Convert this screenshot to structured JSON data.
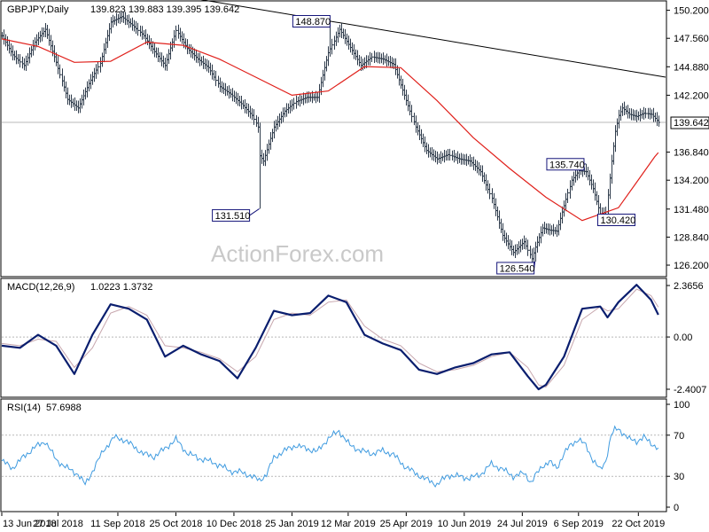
{
  "header": {
    "symbol": "GBPJPY,Daily",
    "ohlc": "139.823 139.883 139.395 139.642"
  },
  "watermark": "ActionForex.com",
  "colors": {
    "background": "#ffffff",
    "price_bars": "#2d3a4a",
    "sma": "#e0201b",
    "trendline": "#000000",
    "macd_line": "#0a1e6e",
    "macd_signal": "#c7a6ad",
    "rsi_line": "#3f9be0",
    "current_price_label_bg": "#ffffff",
    "annotation_border": "#15157a"
  },
  "chart_data": [
    {
      "type": "line",
      "title": "GBPJPY,Daily",
      "subtitle": "139.823 139.883 139.395 139.642",
      "ylim": [
        125.2,
        151.0
      ],
      "y_ticks": [
        "150.200",
        "147.560",
        "144.880",
        "142.200",
        "139.642",
        "136.840",
        "134.200",
        "131.480",
        "128.840",
        "126.200"
      ],
      "x_ticks": [
        {
          "label": "13 Jun 2018",
          "index": 0
        },
        {
          "label": "27 Jul 2018",
          "index": 31
        },
        {
          "label": "11 Sep 2018",
          "index": 64
        },
        {
          "label": "25 Oct 2018",
          "index": 96
        },
        {
          "label": "10 Dec 2018",
          "index": 128
        },
        {
          "label": "25 Jan 2019",
          "index": 160
        },
        {
          "label": "12 Mar 2019",
          "index": 191
        },
        {
          "label": "25 Apr 2019",
          "index": 223
        },
        {
          "label": "10 Jun 2019",
          "index": 255
        },
        {
          "label": "24 Jul 2019",
          "index": 287
        },
        {
          "label": "6 Sep 2019",
          "index": 318
        },
        {
          "label": "22 Oct 2019",
          "index": 351
        }
      ],
      "last_price": {
        "value": 139.642,
        "label": "139.642"
      },
      "annotations": [
        {
          "label": "148.870",
          "index": 181,
          "value": 148.87
        },
        {
          "label": "131.510",
          "index": 142,
          "value": 131.51
        },
        {
          "label": "135.740",
          "index": 322,
          "value": 135.74
        },
        {
          "label": "130.420",
          "index": 333,
          "value": 130.42
        },
        {
          "label": "126.540",
          "index": 294,
          "value": 126.54
        }
      ],
      "trendline": [
        {
          "index": 110,
          "value": 151.2
        },
        {
          "index": 366,
          "value": 143.9
        }
      ],
      "series": [
        {
          "type": "close",
          "x": [
            0,
            6,
            12,
            18,
            24,
            30,
            36,
            42,
            48,
            54,
            60,
            66,
            72,
            78,
            84,
            90,
            96,
            102,
            108,
            114,
            120,
            126,
            132,
            138,
            141,
            142,
            144,
            150,
            156,
            162,
            168,
            174,
            180,
            186,
            192,
            198,
            204,
            210,
            216,
            222,
            228,
            234,
            240,
            246,
            252,
            258,
            264,
            270,
            276,
            282,
            288,
            292,
            294,
            298,
            302,
            306,
            310,
            314,
            318,
            322,
            326,
            330,
            333,
            336,
            338,
            340,
            342,
            346,
            350,
            354,
            358,
            362
          ],
          "values": [
            147.8,
            146.0,
            145.0,
            147.2,
            148.4,
            145.3,
            141.8,
            141.0,
            143.3,
            145.2,
            149.1,
            149.6,
            148.8,
            147.8,
            146.3,
            145.0,
            148.3,
            146.6,
            145.6,
            144.8,
            143.0,
            142.3,
            141.4,
            140.3,
            139.2,
            136.5,
            136.0,
            139.2,
            140.7,
            141.6,
            142.0,
            142.0,
            146.2,
            148.4,
            146.7,
            145.0,
            145.8,
            145.6,
            145.1,
            142.2,
            139.2,
            137.0,
            136.2,
            136.6,
            136.2,
            136.0,
            135.0,
            132.5,
            129.0,
            127.4,
            128.4,
            126.8,
            127.9,
            129.7,
            129.5,
            129.4,
            131.8,
            134.2,
            135.1,
            135.0,
            133.4,
            131.0,
            131.2,
            136.0,
            138.8,
            140.3,
            141.0,
            140.4,
            140.2,
            140.5,
            140.4,
            139.642
          ]
        },
        {
          "type": "sma",
          "x": [
            0,
            20,
            40,
            60,
            80,
            100,
            120,
            140,
            160,
            180,
            200,
            220,
            240,
            260,
            280,
            300,
            320,
            340,
            350,
            360,
            362
          ],
          "values": [
            147.5,
            146.8,
            145.3,
            145.4,
            147.2,
            146.9,
            145.6,
            143.9,
            142.2,
            142.6,
            144.9,
            144.8,
            141.7,
            138.2,
            135.3,
            132.6,
            130.4,
            131.6,
            134.0,
            136.4,
            136.8
          ]
        }
      ]
    },
    {
      "type": "line",
      "title": "MACD(12,26,9)",
      "subtitle": "1.0223 1.3732",
      "ylim": [
        -2.4007,
        2.3656
      ],
      "y_ticks": [
        "2.3656",
        "0.00",
        "-2.4007"
      ],
      "series": [
        {
          "type": "macd",
          "x": [
            0,
            10,
            20,
            30,
            40,
            50,
            60,
            70,
            80,
            90,
            100,
            110,
            120,
            130,
            140,
            150,
            160,
            170,
            180,
            190,
            200,
            210,
            220,
            230,
            240,
            250,
            260,
            270,
            280,
            290,
            296,
            300,
            310,
            320,
            330,
            334,
            340,
            350,
            358,
            362
          ],
          "values": [
            -0.4,
            -0.5,
            0.1,
            -0.4,
            -1.7,
            0.1,
            1.5,
            1.3,
            0.8,
            -0.9,
            -0.4,
            -0.8,
            -1.1,
            -1.9,
            -0.5,
            1.2,
            1.0,
            1.1,
            1.9,
            1.6,
            0.1,
            -0.3,
            -0.6,
            -1.5,
            -1.7,
            -1.4,
            -1.2,
            -0.8,
            -0.7,
            -1.8,
            -2.4,
            -2.2,
            -0.9,
            1.3,
            1.4,
            0.9,
            1.6,
            2.4,
            1.7,
            1.0223
          ]
        },
        {
          "type": "signal",
          "x": [
            0,
            10,
            20,
            30,
            40,
            50,
            60,
            70,
            80,
            90,
            100,
            110,
            120,
            130,
            140,
            150,
            160,
            170,
            180,
            190,
            200,
            210,
            220,
            230,
            240,
            250,
            260,
            270,
            280,
            290,
            296,
            300,
            310,
            320,
            330,
            334,
            340,
            350,
            358,
            362
          ],
          "values": [
            -0.3,
            -0.4,
            -0.1,
            -0.2,
            -1.4,
            -0.5,
            1.1,
            1.4,
            1.0,
            -0.4,
            -0.5,
            -0.7,
            -1.0,
            -1.6,
            -0.9,
            0.8,
            1.1,
            1.0,
            1.6,
            1.7,
            0.5,
            -0.1,
            -0.4,
            -1.2,
            -1.6,
            -1.5,
            -1.3,
            -0.9,
            -0.7,
            -1.4,
            -2.2,
            -2.3,
            -1.3,
            0.8,
            1.4,
            1.2,
            1.3,
            2.2,
            1.9,
            1.3732
          ]
        }
      ]
    },
    {
      "type": "line",
      "title": "RSI(14)",
      "subtitle": "57.6988",
      "ylim": [
        0,
        100
      ],
      "y_ticks": [
        "100",
        "70",
        "30",
        "0"
      ],
      "series": [
        {
          "type": "rsi",
          "x": [
            0,
            6,
            12,
            18,
            24,
            30,
            36,
            42,
            46,
            50,
            56,
            62,
            68,
            72,
            78,
            84,
            90,
            96,
            102,
            108,
            114,
            120,
            126,
            132,
            138,
            142,
            146,
            150,
            156,
            162,
            168,
            174,
            180,
            186,
            192,
            198,
            204,
            210,
            216,
            222,
            228,
            234,
            240,
            246,
            252,
            258,
            264,
            270,
            276,
            282,
            288,
            292,
            294,
            298,
            302,
            306,
            310,
            314,
            318,
            322,
            326,
            330,
            333,
            336,
            338,
            340,
            342,
            346,
            350,
            354,
            358,
            362
          ],
          "values": [
            45,
            38,
            49,
            58,
            64,
            46,
            38,
            32,
            22,
            35,
            55,
            68,
            65,
            60,
            52,
            49,
            57,
            66,
            53,
            48,
            45,
            41,
            35,
            34,
            30,
            26,
            32,
            48,
            55,
            60,
            57,
            54,
            67,
            74,
            60,
            55,
            52,
            55,
            51,
            40,
            33,
            27,
            22,
            31,
            30,
            28,
            32,
            42,
            37,
            30,
            33,
            24,
            30,
            40,
            44,
            38,
            52,
            61,
            66,
            60,
            46,
            36,
            45,
            70,
            75,
            76,
            73,
            66,
            64,
            68,
            62,
            57.6988
          ]
        }
      ]
    }
  ]
}
